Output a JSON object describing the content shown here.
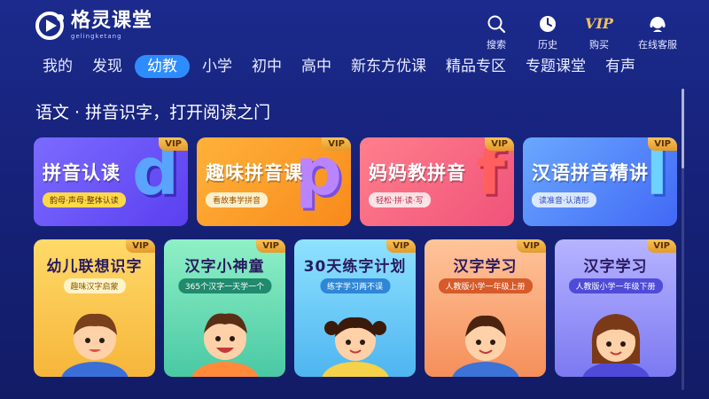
{
  "app": {
    "name": "格灵课堂",
    "name_sub": "gelingketang"
  },
  "actions": [
    {
      "label": "搜索",
      "icon": "search-icon"
    },
    {
      "label": "历史",
      "icon": "clock-icon"
    },
    {
      "label": "购买",
      "icon": "vip-icon",
      "glyph": "VIP"
    },
    {
      "label": "在线客服",
      "icon": "headset-icon"
    }
  ],
  "nav": [
    "我的",
    "发现",
    "幼教",
    "小学",
    "初中",
    "高中",
    "新东方优课",
    "精品专区",
    "专题课堂",
    "有声"
  ],
  "nav_active": "幼教",
  "section": {
    "title": "语文 · 拼音识字，打开阅读之门"
  },
  "row1": [
    {
      "title": "拼音认读",
      "subtitle": "韵母·声母·整体认读",
      "letter": "d",
      "badge": "VIP"
    },
    {
      "title": "趣味拼音课",
      "subtitle": "看故事学拼音",
      "letter": "p",
      "badge": "VIP"
    },
    {
      "title": "妈妈教拼音",
      "subtitle": "轻松·拼·读·写",
      "letter": "f",
      "badge": "VIP"
    },
    {
      "title": "汉语拼音精讲",
      "subtitle": "读准音·认清形",
      "letter": "l",
      "badge": "VIP"
    }
  ],
  "row2": [
    {
      "title": "幼儿联想识字",
      "subtitle": "趣味汉字启蒙",
      "badge": "VIP"
    },
    {
      "title": "汉字小神童",
      "subtitle": "365个汉字一天学一个",
      "badge": "VIP"
    },
    {
      "title": "30天练字计划",
      "subtitle": "练字学习两不误",
      "badge": "VIP"
    },
    {
      "title": "汉字学习",
      "subtitle": "人教版小学一年级上册",
      "badge": "VIP"
    },
    {
      "title": "汉字学习",
      "subtitle": "人教版小学一年级下册",
      "badge": "VIP"
    }
  ],
  "colors": {
    "background": "#16227a",
    "accent": "#2d8cff",
    "vip": "#f2c35b"
  }
}
